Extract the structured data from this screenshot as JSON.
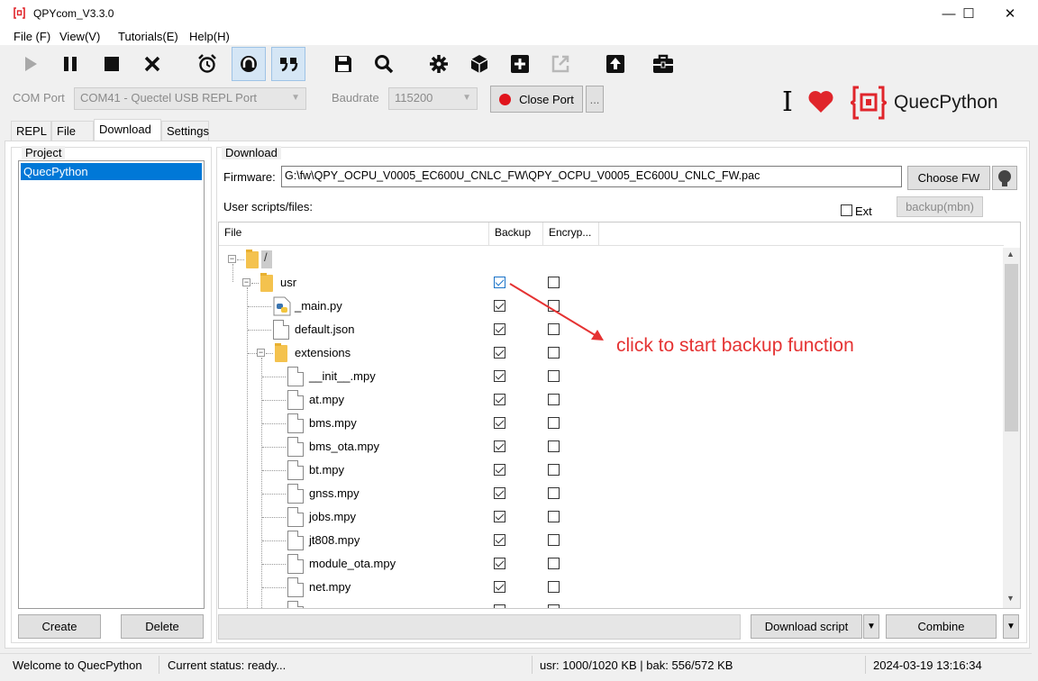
{
  "window": {
    "title": "QPYcom_V3.3.0",
    "controls": {
      "minimize": "—",
      "maximize": "☐",
      "close": "✕"
    }
  },
  "menu": [
    "File (F)",
    "View(V)",
    "Tutorials(E)",
    "Help(H)"
  ],
  "toolbar": {
    "icons": [
      "play-icon",
      "pause-icon",
      "stop-icon",
      "clear-icon",
      "alarm-clock-icon",
      "terminal-icon",
      "quote-icon",
      "save-icon",
      "search-icon",
      "gear-icon",
      "package-icon",
      "add-icon",
      "export-icon",
      "upload-icon",
      "toolbox-icon"
    ]
  },
  "com": {
    "port_label": "COM Port",
    "port_value": "COM41 - Quectel USB REPL Port",
    "baud_label": "Baudrate",
    "baud_value": "115200",
    "close_port": "Close Port",
    "more": "..."
  },
  "brand": {
    "cursor": "I",
    "name": "QuecPython",
    "accent": "#e0252b"
  },
  "tabs": [
    "REPL",
    "File",
    "Download",
    "Settings"
  ],
  "project": {
    "title": "Project",
    "items": [
      "QuecPython"
    ],
    "create": "Create",
    "delete": "Delete"
  },
  "download": {
    "title": "Download",
    "firmware_label": "Firmware:",
    "firmware_path": "G:\\fw\\QPY_OCPU_V0005_EC600U_CNLC_FW\\QPY_OCPU_V0005_EC600U_CNLC_FW.pac",
    "choose_fw": "Choose FW",
    "user_scripts_label": "User scripts/files:",
    "ext_label": "Ext",
    "backup_mbn": "backup(mbn)",
    "columns": [
      "File",
      "Backup",
      "Encryp..."
    ],
    "files": [
      {
        "name": "/",
        "backup": null,
        "encrypt": null
      },
      {
        "name": "usr",
        "backup": true,
        "encrypt": false
      },
      {
        "name": "_main.py",
        "backup": true,
        "encrypt": false
      },
      {
        "name": "default.json",
        "backup": true,
        "encrypt": false
      },
      {
        "name": "extensions",
        "backup": true,
        "encrypt": false
      },
      {
        "name": "__init__.mpy",
        "backup": true,
        "encrypt": false
      },
      {
        "name": "at.mpy",
        "backup": true,
        "encrypt": false
      },
      {
        "name": "bms.mpy",
        "backup": true,
        "encrypt": false
      },
      {
        "name": "bms_ota.mpy",
        "backup": true,
        "encrypt": false
      },
      {
        "name": "bt.mpy",
        "backup": true,
        "encrypt": false
      },
      {
        "name": "gnss.mpy",
        "backup": true,
        "encrypt": false
      },
      {
        "name": "jobs.mpy",
        "backup": true,
        "encrypt": false
      },
      {
        "name": "jt808.mpy",
        "backup": true,
        "encrypt": false
      },
      {
        "name": "module_ota.mpy",
        "backup": true,
        "encrypt": false
      },
      {
        "name": "net.mpy",
        "backup": true,
        "encrypt": false
      }
    ],
    "annotation": "click to start backup function",
    "download_script": "Download script",
    "combine": "Combine"
  },
  "status": {
    "welcome": "Welcome to QuecPython",
    "current": "Current status: ready...",
    "usage": "usr: 1000/1020 KB | bak: 556/572 KB",
    "datetime": "2024-03-19 13:16:34"
  }
}
